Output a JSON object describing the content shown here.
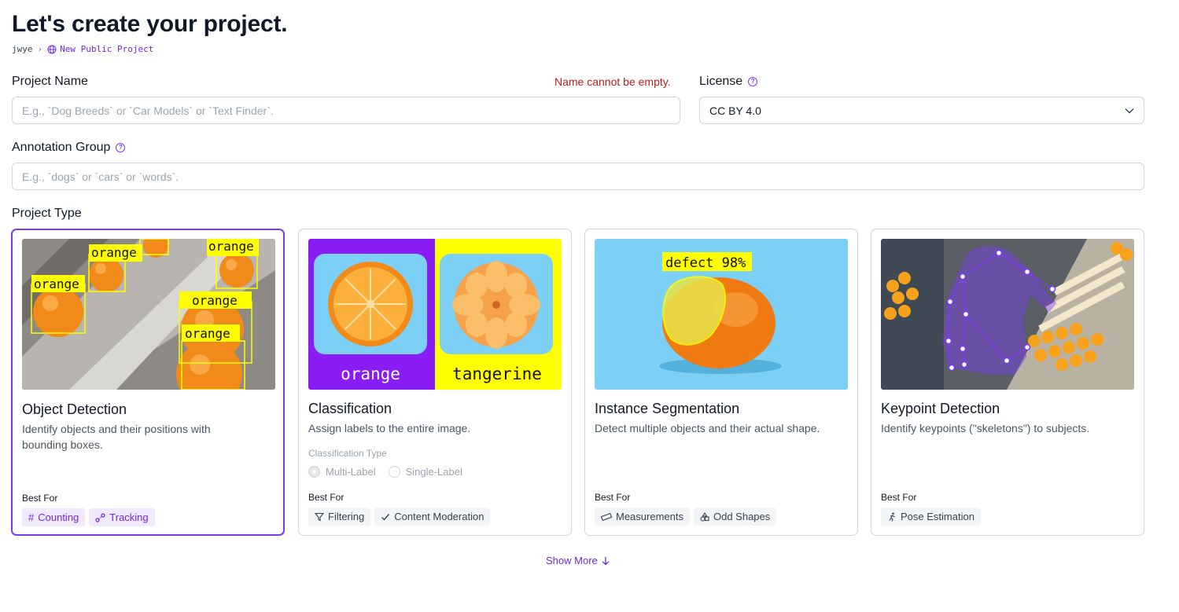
{
  "page": {
    "title": "Let's create your project.",
    "breadcrumb": {
      "user": "jwye",
      "project": "New Public Project"
    }
  },
  "form": {
    "project_name": {
      "label": "Project Name",
      "placeholder": "E.g., `Dog Breeds` or `Car Models` or `Text Finder`.",
      "value": "",
      "error": "Name cannot be empty."
    },
    "license": {
      "label": "License",
      "value": "CC BY 4.0"
    },
    "annotation_group": {
      "label": "Annotation Group",
      "placeholder": "E.g., `dogs` or `cars` or `words`.",
      "value": ""
    },
    "project_type_label": "Project Type"
  },
  "cards": [
    {
      "name": "Object Detection",
      "description": "Identify objects and their positions with bounding boxes.",
      "best_for_label": "Best For",
      "tags": [
        "Counting",
        "Tracking"
      ],
      "image_labels": [
        "orange",
        "orange",
        "orange",
        "orange",
        "orange"
      ],
      "selected": true
    },
    {
      "name": "Classification",
      "description": "Assign labels to the entire image.",
      "classification_type_label": "Classification Type",
      "options": [
        "Multi-Label",
        "Single-Label"
      ],
      "best_for_label": "Best For",
      "tags": [
        "Filtering",
        "Content Moderation"
      ],
      "image_labels": [
        "orange",
        "tangerine"
      ]
    },
    {
      "name": "Instance Segmentation",
      "description": "Detect multiple objects and their actual shape.",
      "best_for_label": "Best For",
      "tags": [
        "Measurements",
        "Odd Shapes"
      ],
      "image_labels": [
        "defect 98%"
      ]
    },
    {
      "name": "Keypoint Detection",
      "description": "Identify keypoints (\"skeletons\") to subjects.",
      "best_for_label": "Best For",
      "tags": [
        "Pose Estimation"
      ]
    }
  ],
  "show_more": "Show More",
  "colors": {
    "accent": "#7c3aed",
    "error": "#b91c1c",
    "label_yellow": "#ffff00",
    "sky": "#7ccff5"
  }
}
